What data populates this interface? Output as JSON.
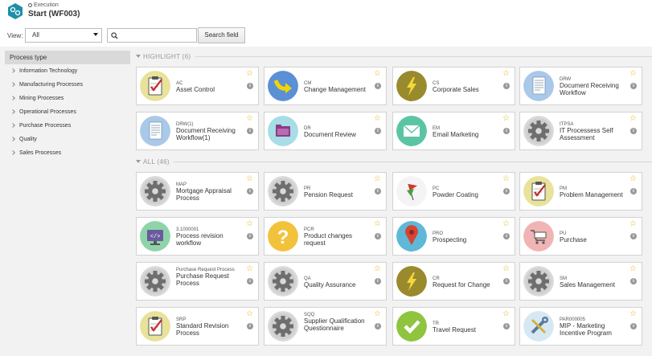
{
  "header": {
    "breadcrumb": "Execution",
    "title": "Start (WF003)"
  },
  "toolbar": {
    "view_label": "View:",
    "view_value": "All",
    "search_placeholder": "",
    "search_button": "Search field"
  },
  "sidebar": {
    "title": "Process type",
    "items": [
      {
        "label": "Information Technology"
      },
      {
        "label": "Manufacturing Processes"
      },
      {
        "label": "Mining Processes"
      },
      {
        "label": "Operational Processes"
      },
      {
        "label": "Purchase Processes"
      },
      {
        "label": "Quality"
      },
      {
        "label": "Sales Processes"
      }
    ]
  },
  "highlight": {
    "label": "HIGHLIGHT (6)",
    "cards": [
      {
        "code": "AC",
        "name": "Asset Control",
        "icon": "clipboard-check-icon",
        "color": "#e8e29a"
      },
      {
        "code": "CM",
        "name": "Change Management",
        "icon": "curved-arrow-icon",
        "color": "#5b8fd6"
      },
      {
        "code": "CS",
        "name": "Corporate Sales",
        "icon": "lightning-icon",
        "color": "#9a8a2e"
      },
      {
        "code": "DRW",
        "name": "Document Receiving Workflow",
        "icon": "document-icon",
        "color": "#aac8e8"
      },
      {
        "code": "DRW(1)",
        "name": "Document Receiving Workflow(1)",
        "icon": "document-icon",
        "color": "#aac8e8"
      },
      {
        "code": "DR",
        "name": "Document Review",
        "icon": "folder-icon",
        "color": "#a6dde6"
      },
      {
        "code": "EM",
        "name": "Email Marketing",
        "icon": "envelope-icon",
        "color": "#5bc4a4"
      },
      {
        "code": "ITPSA",
        "name": "IT Processess Self Assessment",
        "icon": "gear-icon",
        "color": "#d9d9d9"
      }
    ]
  },
  "all": {
    "label": "ALL (46)",
    "cards": [
      {
        "code": "MAP",
        "name": "Mortgage Appraisal Process",
        "icon": "gear-icon",
        "color": "#d9d9d9"
      },
      {
        "code": "PR",
        "name": "Pension Request",
        "icon": "gear-icon",
        "color": "#d9d9d9"
      },
      {
        "code": "PC",
        "name": "Powder Coating",
        "icon": "flags-icon",
        "color": "#f4f4f4"
      },
      {
        "code": "PM",
        "name": "Problem Management",
        "icon": "clipboard-check-icon",
        "color": "#e8e29a"
      },
      {
        "code": "3.1000001",
        "name": "Process revision workflow",
        "icon": "monitor-code-icon",
        "color": "#8fd4a8"
      },
      {
        "code": "PCR",
        "name": "Product changes request",
        "icon": "question-icon",
        "color": "#f2c23b"
      },
      {
        "code": "PRO",
        "name": "Prospecting",
        "icon": "map-pin-icon",
        "color": "#5fb8d8"
      },
      {
        "code": "PU",
        "name": "Purchase",
        "icon": "shopping-cart-icon",
        "color": "#f1b4b4"
      },
      {
        "code": "Purchase Request Process",
        "name": "Purchase Request Process",
        "icon": "gear-icon",
        "color": "#d9d9d9"
      },
      {
        "code": "QA",
        "name": "Quality Assurance",
        "icon": "gear-icon",
        "color": "#d9d9d9"
      },
      {
        "code": "CR",
        "name": "Request for Change",
        "icon": "lightning-icon",
        "color": "#9a8a2e"
      },
      {
        "code": "SM",
        "name": "Sales Management",
        "icon": "gear-icon",
        "color": "#d9d9d9"
      },
      {
        "code": "SRP",
        "name": "Standard Revision Process",
        "icon": "clipboard-check-icon",
        "color": "#e8e29a"
      },
      {
        "code": "SQQ",
        "name": "Supplier Qualification Questionnaire",
        "icon": "gear-icon",
        "color": "#d9d9d9"
      },
      {
        "code": "TR",
        "name": "Travel Request",
        "icon": "checkmark-icon",
        "color": "#8fc43f"
      },
      {
        "code": "PAR000005",
        "name": "MIP - Marketing Incentive Program",
        "icon": "wrench-icon",
        "color": "#d6e8f4"
      }
    ]
  }
}
